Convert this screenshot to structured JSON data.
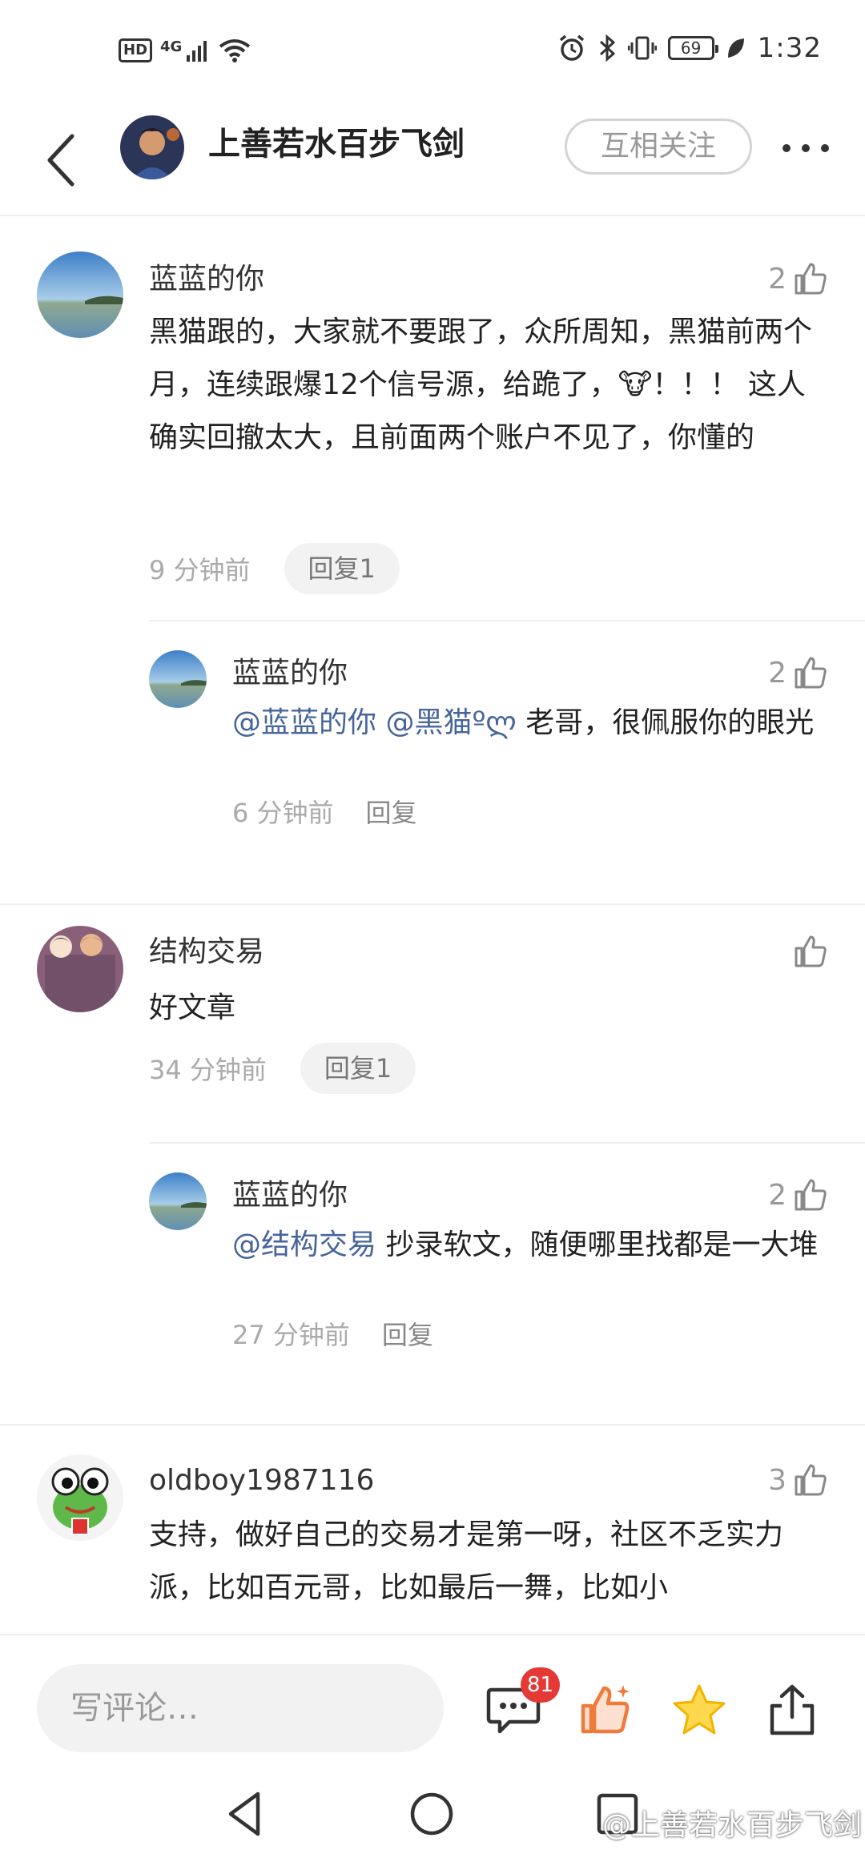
{
  "status_bar": {
    "hd": "HD",
    "network": "4G",
    "battery": "69",
    "time": "1:32"
  },
  "header": {
    "title": "上善若水百步飞剑",
    "follow_label": "互相关注"
  },
  "comments": [
    {
      "user": "蓝蓝的你",
      "likes": "2",
      "text": "黑猫跟的，大家就不要跟了，众所周知，黑猫前两个月，连续跟爆12个信号源，给跪了，🐮！！！ 这人确实回撤太大，且前面两个账户不见了，你懂的",
      "time": "9 分钟前",
      "reply_label": "回复1",
      "reply": {
        "user": "蓝蓝的你",
        "likes": "2",
        "mentions": [
          "@蓝蓝的你",
          "@黑猫ºლ"
        ],
        "text": " 老哥，很佩服你的眼光",
        "time": "6 分钟前",
        "reply_label": "回复"
      }
    },
    {
      "user": "结构交易",
      "likes": "",
      "text": "好文章",
      "time": "34 分钟前",
      "reply_label": "回复1",
      "reply": {
        "user": "蓝蓝的你",
        "likes": "2",
        "mentions": [
          "@结构交易"
        ],
        "text": " 抄录软文，随便哪里找都是一大堆",
        "time": "27 分钟前",
        "reply_label": "回复"
      }
    },
    {
      "user": "oldboy1987116",
      "likes": "3",
      "text": "支持，做好自己的交易才是第一呀，社区不乏实力派，比如百元哥，比如最后一舞，比如小"
    }
  ],
  "bottom_bar": {
    "input_placeholder": "写评论…",
    "comment_count": "81"
  },
  "watermark": "@上善若水百步飞剑"
}
